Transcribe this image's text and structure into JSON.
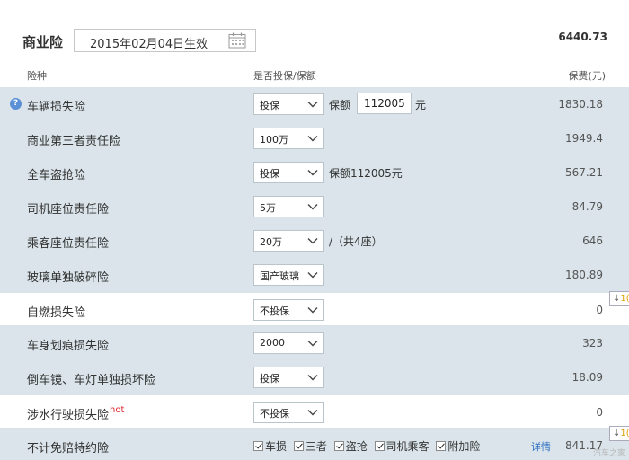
{
  "header": {
    "section_title": "商业险",
    "effective_date": "2015年02月04日生效",
    "total": "6440.73"
  },
  "columns": {
    "name": "险种",
    "option": "是否投保/保额",
    "fee": "保费(元)"
  },
  "rows": [
    {
      "name": "车辆损失险",
      "select": "投保",
      "amount_label": "保额",
      "amount": "112005",
      "amount_unit": "元",
      "fee": "1830.18"
    },
    {
      "name": "商业第三者责任险",
      "select": "100万",
      "fee": "1949.4"
    },
    {
      "name": "全车盗抢险",
      "select": "投保",
      "after": "保额112005元",
      "fee": "567.21"
    },
    {
      "name": "司机座位责任险",
      "select": "5万",
      "fee": "84.79"
    },
    {
      "name": "乘客座位责任险",
      "select": "20万",
      "after": "/（共4座）",
      "fee": "646"
    },
    {
      "name": "玻璃单独破碎险",
      "select": "国产玻璃",
      "fee": "180.89"
    },
    {
      "name": "自燃损失险",
      "select": "不投保",
      "fee": "0"
    },
    {
      "name": "车身划痕损失险",
      "select": "2000",
      "fee": "323"
    },
    {
      "name": "倒车镜、车灯单独损坏险",
      "select": "投保",
      "fee": "18.09"
    },
    {
      "name": "涉水行驶损失险",
      "hot": "hot",
      "select": "不投保",
      "fee": "0"
    },
    {
      "name": "不计免赔特约险",
      "fee": "841.17"
    }
  ],
  "deductible_options": [
    "车损",
    "三者",
    "盗抢",
    "司机乘客",
    "附加险"
  ],
  "detail_link": "详情",
  "side_tips": [
    {
      "arrow": "↓",
      "num": "1("
    },
    {
      "arrow": "↓",
      "num": "1("
    }
  ],
  "watermark": "汽车之家",
  "colors": {
    "row_gray": "#dae4ea",
    "link": "#2c6fc2",
    "hot": "#e0252b"
  }
}
